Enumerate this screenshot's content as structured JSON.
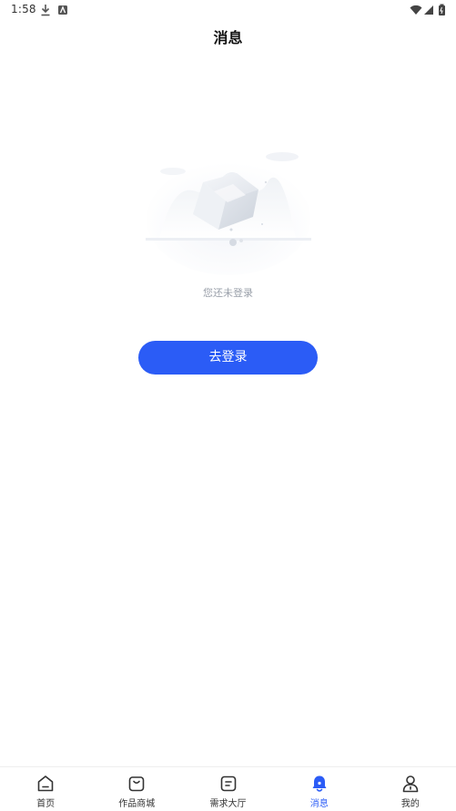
{
  "status_bar": {
    "time": "1:58"
  },
  "header": {
    "title": "消息"
  },
  "empty_state": {
    "message": "您还未登录",
    "button_label": "去登录"
  },
  "tab_bar": {
    "tabs": [
      {
        "label": "首页",
        "icon": "home-icon",
        "active": false
      },
      {
        "label": "作品商城",
        "icon": "shopping-bag-icon",
        "active": false
      },
      {
        "label": "需求大厅",
        "icon": "list-doc-icon",
        "active": false
      },
      {
        "label": "消息",
        "icon": "bell-icon",
        "active": true
      },
      {
        "label": "我的",
        "icon": "person-icon",
        "active": false
      }
    ],
    "active_color": "#2b5cf6",
    "inactive_color": "#333333"
  },
  "colors": {
    "accent": "#2b5cf6",
    "muted_text": "#9aa0aa"
  }
}
